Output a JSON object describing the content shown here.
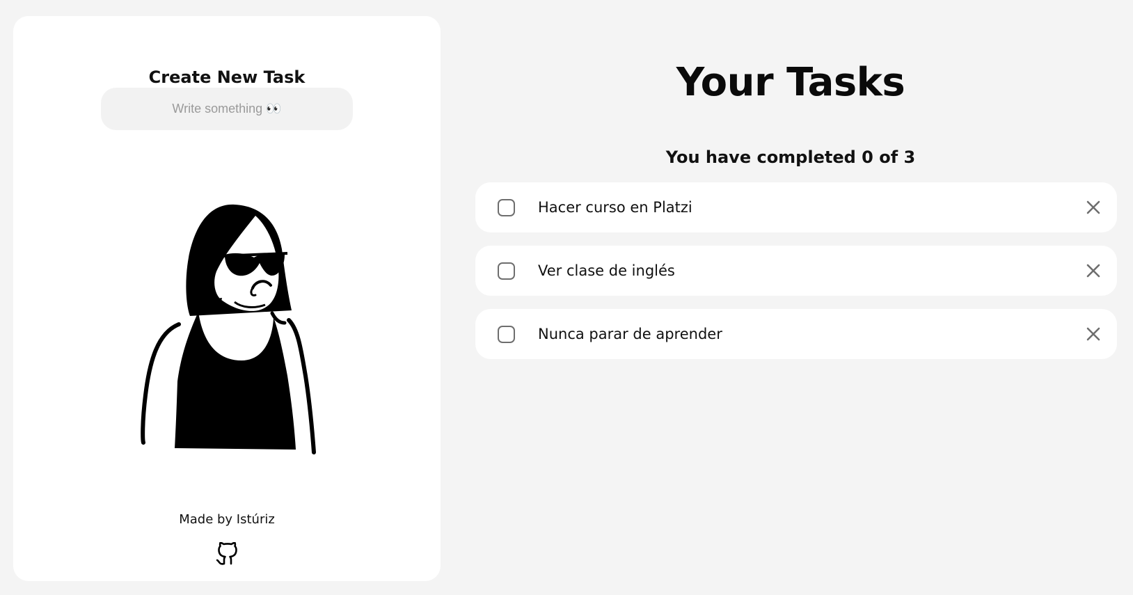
{
  "create_panel": {
    "title": "Create New Task",
    "input": {
      "placeholder": "Write something 👀",
      "value": ""
    },
    "illustration_icon": "woman-with-sunglasses-illustration",
    "credit": "Made by Istúriz",
    "github_icon": "github-icon"
  },
  "tasks_panel": {
    "title": "Your Tasks",
    "counter": "You have completed 0 of 3",
    "completed_count": 0,
    "total_count": 3,
    "tasks": [
      {
        "text": "Hacer curso en Platzi",
        "completed": false
      },
      {
        "text": "Ver clase de inglés",
        "completed": false
      },
      {
        "text": "Nunca parar de aprender",
        "completed": false
      }
    ]
  },
  "colors": {
    "page_background": "#f4f4f4",
    "card_background": "#ffffff",
    "input_background": "#f2f2f2",
    "text": "#111111",
    "icon_gray": "#6e6e6e"
  }
}
